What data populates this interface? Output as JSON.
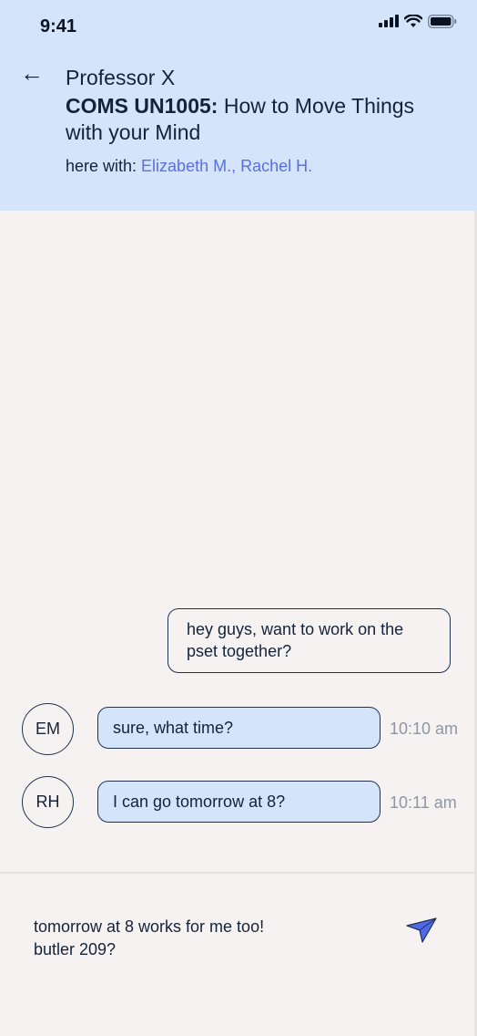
{
  "status_bar": {
    "time": "9:41"
  },
  "header": {
    "professor": "Professor X",
    "course_code": "COMS UN1005:",
    "course_title": " How to Move Things with your Mind",
    "here_with_label": "here with: ",
    "participants": "Elizabeth M., Rachel H."
  },
  "messages": [
    {
      "text": "hey guys, want to work on the pset together?"
    },
    {
      "initials": "EM",
      "text": "sure, what time?",
      "time": "10:10 am"
    },
    {
      "initials": "RH",
      "text": "I can go tomorrow at 8?",
      "time": "10:11 am"
    }
  ],
  "composer": {
    "value": "tomorrow at 8 works for me too!\nbutler 209?"
  },
  "colors": {
    "header_bg": "#d4e4fb",
    "accent": "#5b6fe0",
    "send": "#4f69ea"
  }
}
